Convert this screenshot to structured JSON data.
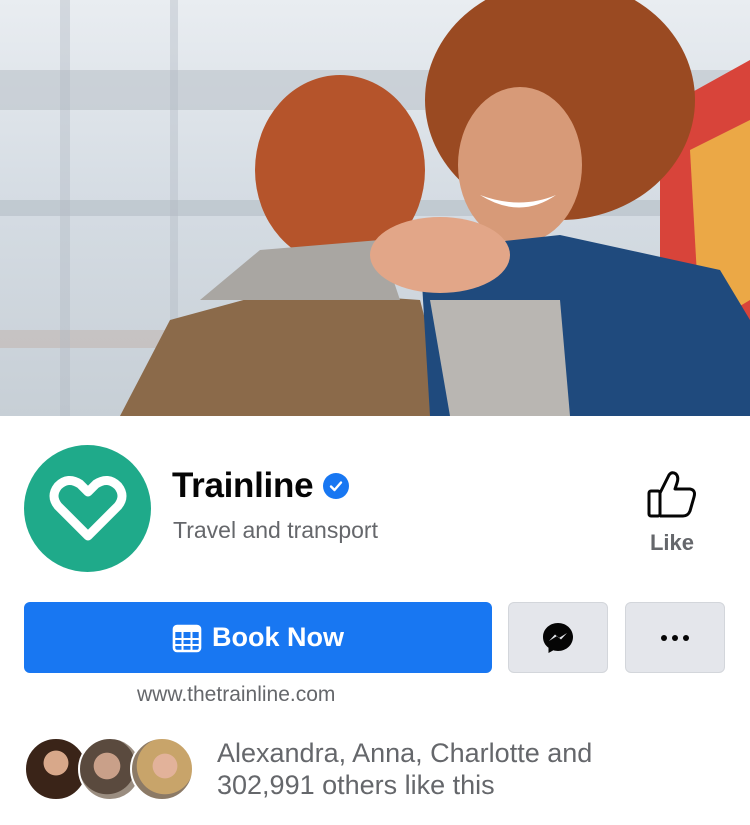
{
  "page": {
    "name": "Trainline",
    "category": "Travel and transport",
    "website": "www.thetrainline.com",
    "verified_icon": "verified-badge-icon"
  },
  "actions": {
    "like_label": "Like",
    "book_label": "Book Now",
    "messenger_icon": "messenger-icon",
    "more_icon": "more-dots-icon"
  },
  "likes": {
    "line1": "Alexandra, Anna, Charlotte and",
    "line2": "302,991 others like this"
  },
  "colors": {
    "brand_blue": "#1877f2",
    "logo_green": "#1faa8a",
    "secondary_text": "#65676b",
    "button_grey": "#e4e6eb"
  }
}
